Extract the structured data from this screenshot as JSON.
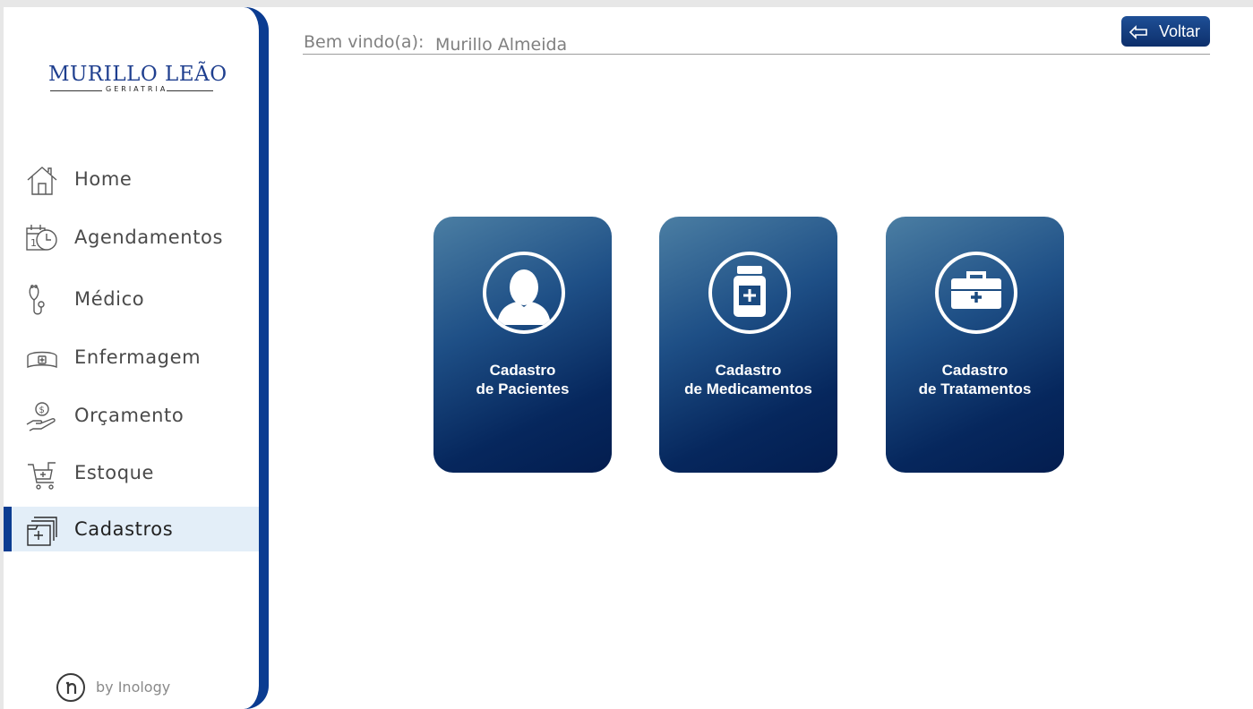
{
  "brand": {
    "logo_main": "MURILLO LEÃO",
    "logo_sub": "GERIATRIA"
  },
  "sidebar": {
    "items": [
      {
        "label": "Home",
        "icon": "home-icon"
      },
      {
        "label": "Agendamentos",
        "icon": "calendar-clock-icon"
      },
      {
        "label": "Médico",
        "icon": "stethoscope-icon"
      },
      {
        "label": "Enfermagem",
        "icon": "nurse-cap-icon"
      },
      {
        "label": "Orçamento",
        "icon": "hand-coin-icon"
      },
      {
        "label": "Estoque",
        "icon": "medical-cart-icon"
      },
      {
        "label": "Cadastros",
        "icon": "medical-folders-icon",
        "active": true
      }
    ],
    "footer": "by Inology"
  },
  "header": {
    "welcome_label": "Bem vindo(a):",
    "user_name": "Murillo Almeida",
    "back_label": "Voltar"
  },
  "cards": [
    {
      "line1": "Cadastro",
      "line2": "de Pacientes",
      "icon": "patient-icon"
    },
    {
      "line1": "Cadastro",
      "line2": "de Medicamentos",
      "icon": "medicine-bottle-icon"
    },
    {
      "line1": "Cadastro",
      "line2": "de Tratamentos",
      "icon": "first-aid-kit-icon"
    }
  ],
  "colors": {
    "primary": "#0b3c91",
    "active_bg": "#e3eef8",
    "card_top": "#4b7ea3",
    "card_bottom": "#031d4f"
  }
}
